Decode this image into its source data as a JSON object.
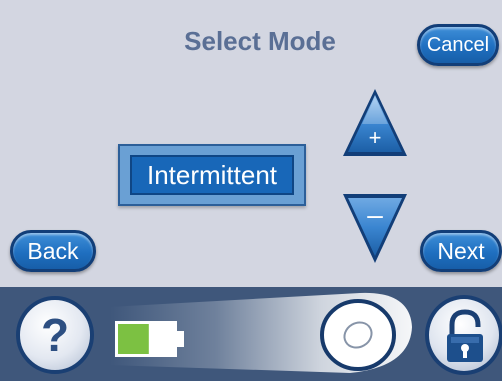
{
  "header": {
    "title": "Select Mode",
    "cancel_label": "Cancel"
  },
  "mode": {
    "current_value": "Intermittent"
  },
  "controls": {
    "increase_symbol": "+",
    "decrease_symbol": "–"
  },
  "nav": {
    "back_label": "Back",
    "next_label": "Next"
  },
  "status_bar": {
    "help_symbol": "?",
    "battery_level": 0.55,
    "icons": [
      "help-icon",
      "battery-icon",
      "slider-knob",
      "lock-icon"
    ]
  },
  "colors": {
    "panel_bg": "#d3d6e1",
    "title": "#5a6f95",
    "button_blue": "#1f6fc0",
    "bar_bg": "#3f577b",
    "battery_green": "#7cc142"
  }
}
